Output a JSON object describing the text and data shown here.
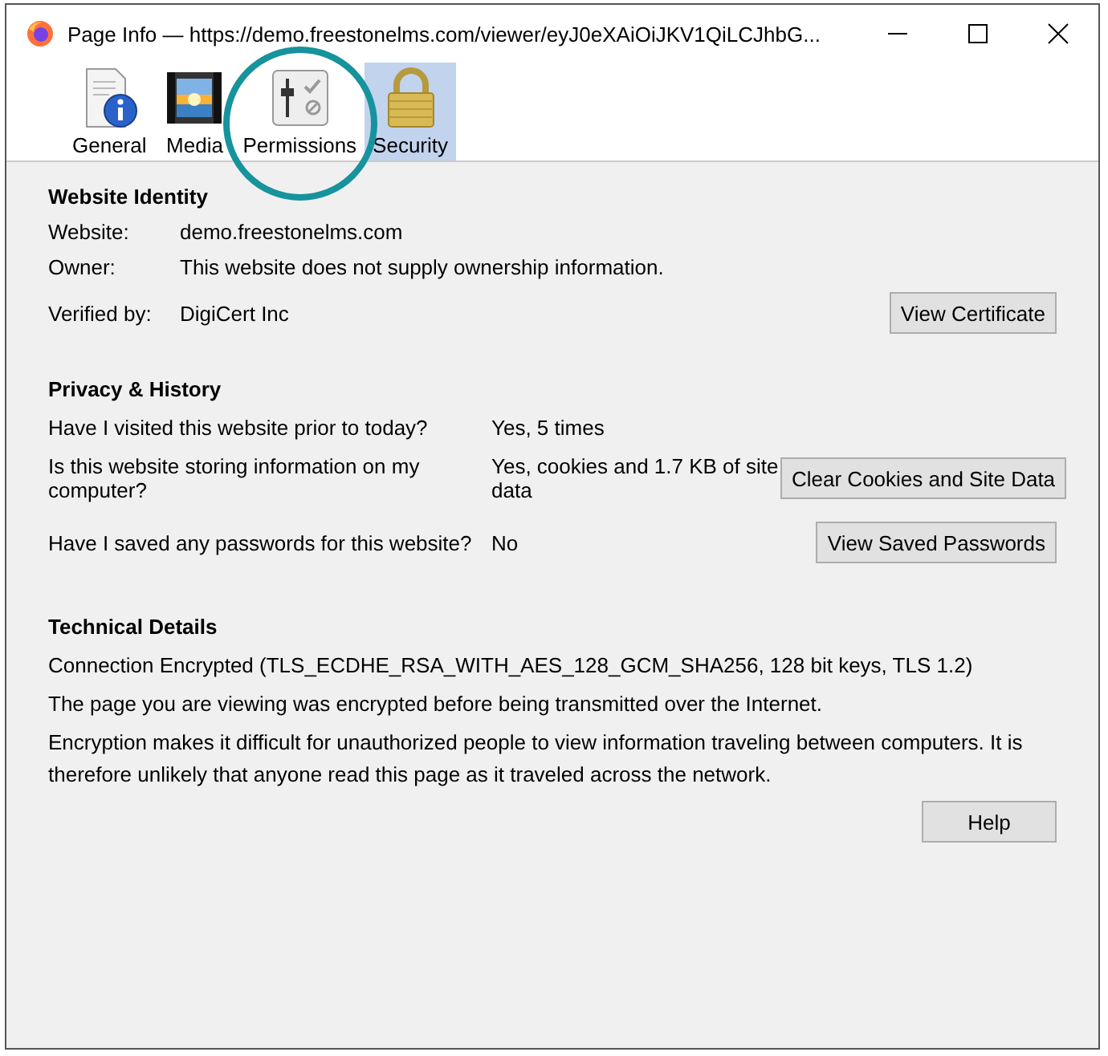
{
  "window": {
    "title": "Page Info — https://demo.freestonelms.com/viewer/eyJ0eXAiOiJKV1QiLCJhbG..."
  },
  "tabs": [
    {
      "label": "General",
      "kind": "general",
      "selected": false,
      "circled": false
    },
    {
      "label": "Media",
      "kind": "media",
      "selected": false,
      "circled": false
    },
    {
      "label": "Permissions",
      "kind": "permissions",
      "selected": false,
      "circled": true
    },
    {
      "label": "Security",
      "kind": "security",
      "selected": true,
      "circled": false
    }
  ],
  "identity": {
    "heading": "Website Identity",
    "rows": [
      {
        "label": "Website:",
        "value": "demo.freestonelms.com"
      },
      {
        "label": "Owner:",
        "value": "This website does not supply ownership information."
      },
      {
        "label": "Verified by:",
        "value": "DigiCert Inc",
        "button": "View Certificate"
      }
    ]
  },
  "privacy": {
    "heading": "Privacy & History",
    "rows": [
      {
        "question": "Have I visited this website prior to today?",
        "answer": "Yes, 5 times"
      },
      {
        "question": "Is this website storing information on my computer?",
        "answer": "Yes, cookies and 1.7 KB of site data",
        "button": "Clear Cookies and Site Data"
      },
      {
        "question": "Have I saved any passwords for this website?",
        "answer": "No",
        "button": "View Saved Passwords"
      }
    ]
  },
  "technical": {
    "heading": "Technical Details",
    "lines": [
      "Connection Encrypted (TLS_ECDHE_RSA_WITH_AES_128_GCM_SHA256, 128 bit keys, TLS 1.2)",
      "The page you are viewing was encrypted before being transmitted over the Internet.",
      "Encryption makes it difficult for unauthorized people to view information traveling between computers. It is therefore unlikely that anyone read this page as it traveled across the network."
    ]
  },
  "buttons": [
    "Help"
  ]
}
